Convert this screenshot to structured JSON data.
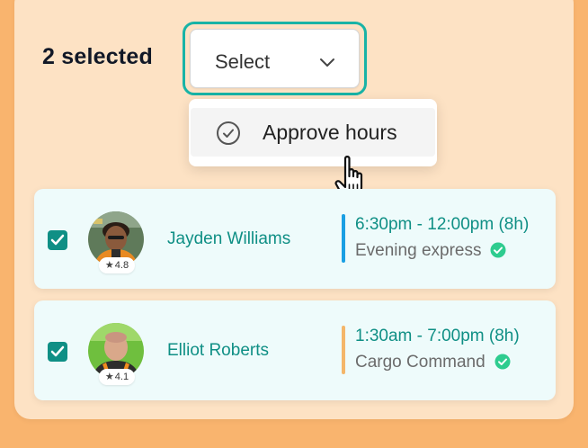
{
  "header": {
    "selected_count": "2 selected",
    "select_label": "Select"
  },
  "dropdown": {
    "items": [
      {
        "label": "Approve hours",
        "icon": "check-circle-icon"
      }
    ]
  },
  "workers": [
    {
      "name": "Jayden Williams",
      "rating": "4.8",
      "shift_time": "6:30pm - 12:00pm (8h)",
      "route": "Evening express",
      "route_color": "#1a9fe3",
      "checked": true
    },
    {
      "name": "Elliot Roberts",
      "rating": "4.1",
      "shift_time": "1:30am - 7:00pm (8h)",
      "route": "Cargo Command",
      "route_color": "#f4b66a",
      "checked": true
    }
  ],
  "colors": {
    "accent": "#18b3a6",
    "teal_text": "#0f8f85",
    "verified": "#2ecc8f",
    "background": "#f9b46e",
    "panel": "#fde2c4",
    "card": "#eefbfb"
  }
}
